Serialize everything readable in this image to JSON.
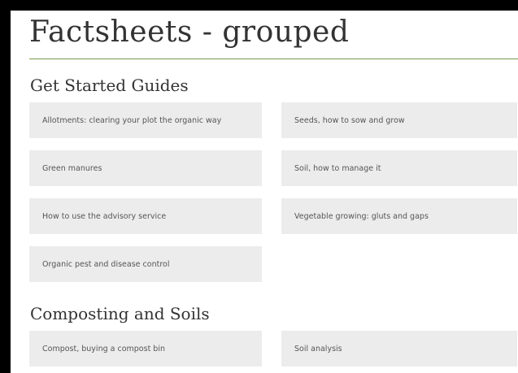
{
  "page_title": "Factsheets - grouped",
  "sections": [
    {
      "heading": "Get Started Guides",
      "items": [
        "Allotments: clearing your plot the organic way",
        "Seeds, how to sow and grow",
        "Green manures",
        "Soil, how to manage it",
        "How to use the advisory service",
        "Vegetable growing: gluts and gaps",
        "Organic pest and disease control"
      ]
    },
    {
      "heading": "Composting and Soils",
      "items": [
        "Compost, buying a compost bin",
        "Soil analysis"
      ]
    }
  ],
  "colors": {
    "accent_rule": "#7a9a4a",
    "card_background": "#ececec",
    "frame": "#000000"
  }
}
